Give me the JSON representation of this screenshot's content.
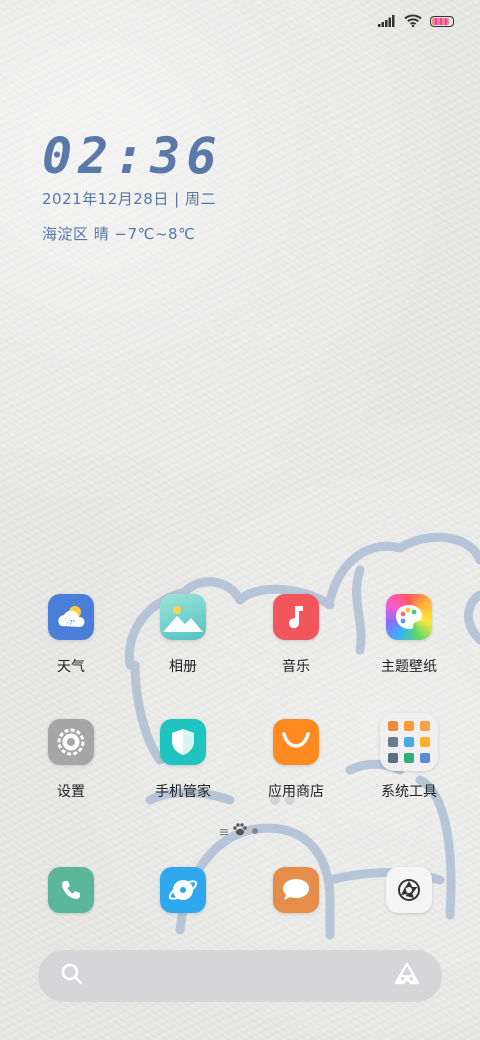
{
  "status_bar": {
    "icons": [
      "cellular-signal-icon",
      "wifi-icon",
      "battery-icon"
    ],
    "battery_level": 0.85
  },
  "clock": {
    "time": "02:36",
    "date": "2021年12月28日 | 周二",
    "weather": "海淀区  晴  −7℃~8℃"
  },
  "apps": [
    {
      "label": "天气",
      "icon": "weather-icon",
      "badge_text": "-7°",
      "color": "#4a7fd8"
    },
    {
      "label": "相册",
      "icon": "gallery-icon",
      "color": "#67cfc4"
    },
    {
      "label": "音乐",
      "icon": "music-icon",
      "color": "#f0565b"
    },
    {
      "label": "主题壁纸",
      "icon": "themes-icon",
      "color": "#f4a236"
    },
    {
      "label": "设置",
      "icon": "settings-icon",
      "color": "#9a9a9a"
    },
    {
      "label": "手机管家",
      "icon": "security-icon",
      "color": "#1fc4c0"
    },
    {
      "label": "应用商店",
      "icon": "app-store-icon",
      "color": "#ff8a1f"
    },
    {
      "label": "系统工具",
      "icon": "folder-icon",
      "color": "#efefef"
    }
  ],
  "dock": [
    {
      "icon": "phone-icon",
      "color": "#5cb69a"
    },
    {
      "icon": "browser-icon",
      "color": "#2fa8ef"
    },
    {
      "icon": "messages-icon",
      "color": "#e58d4a"
    },
    {
      "icon": "camera-icon",
      "color": "#f5f5f5"
    }
  ],
  "search_bar": {
    "left_icon": "search-icon",
    "right_icon": "assistant-icon"
  }
}
